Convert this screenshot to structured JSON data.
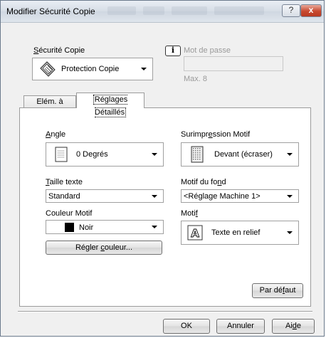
{
  "window": {
    "title": "Modifier Sécurité Copie",
    "help_glyph": "?",
    "close_glyph": "x"
  },
  "security": {
    "label": "Sécurité Copie",
    "value": "Protection Copie",
    "icon": "copy-protection-icon"
  },
  "password": {
    "info_glyph": "i",
    "label": "Mot de passe",
    "value": "",
    "hint": "Max. 8"
  },
  "tabs": [
    {
      "label": "Elém. à imprim."
    },
    {
      "label": "Réglages Détaillés",
      "active": true
    }
  ],
  "details": {
    "angle_label": "Angle",
    "angle_value": "0 Degrés",
    "angle_icon": "angle-grid-icon",
    "overprint_label": "Surimpression Motif",
    "overprint_value": "Devant (écraser)",
    "overprint_icon": "overprint-pattern-icon",
    "text_size_label": "Taille texte",
    "text_size_value": "Standard",
    "background_pattern_label": "Motif du fond",
    "background_pattern_value": "<Réglage Machine 1>",
    "pattern_color_label": "Couleur Motif",
    "pattern_color_value": "Noir",
    "pattern_color_swatch": "#000000",
    "pattern_label": "Motif",
    "pattern_value": "Texte en relief",
    "pattern_icon": "embossed-letter-icon",
    "adjust_color_button": "Régler couleur...",
    "default_button": "Par défaut"
  },
  "footer": {
    "ok": "OK",
    "cancel": "Annuler",
    "help": "Aide"
  }
}
